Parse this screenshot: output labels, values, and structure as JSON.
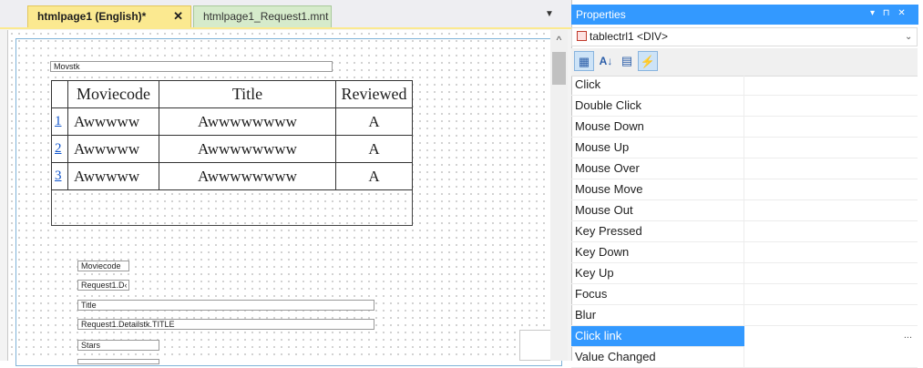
{
  "tabs": {
    "active": "htmlpage1 (English)*",
    "close": "✕",
    "inactive": "htmlpage1_Request1.mnt",
    "dropdown": "▼"
  },
  "designer": {
    "scroll_up": "^",
    "movstk_label": "Movstk",
    "table": {
      "headers": [
        "",
        "Moviecode",
        "Title",
        "Reviewed"
      ],
      "rows": [
        {
          "num": "1",
          "code": "Awwwww",
          "title": "Awwwwwwww",
          "reviewed": "A"
        },
        {
          "num": "2",
          "code": "Awwwww",
          "title": "Awwwwwwww",
          "reviewed": "A"
        },
        {
          "num": "3",
          "code": "Awwwww",
          "title": "Awwwwwwww",
          "reviewed": "A"
        }
      ]
    },
    "fields": {
      "moviecode": "Moviecode",
      "request1_d": "Request1.D‹",
      "title": "Title",
      "request1_title": "Request1.Detailstk.TITLE",
      "stars": "Stars"
    }
  },
  "properties": {
    "title": "Properties",
    "title_icons": "▾ ⊓ ✕",
    "object": "tablectrl1 <DIV>",
    "object_chevron": "⌄",
    "toolbar": {
      "categorized": "▦",
      "alphabetical": "A↓",
      "props": "▤",
      "events": "⚡"
    },
    "events": [
      "Click",
      "Double Click",
      "Mouse Down",
      "Mouse Up",
      "Mouse Over",
      "Mouse Move",
      "Mouse Out",
      "Key Pressed",
      "Key Down",
      "Key Up",
      "Focus",
      "Blur",
      "Click link",
      "Value Changed"
    ],
    "selected_event": "Click link",
    "ellipsis": "..."
  },
  "colors": {
    "accent": "#3399ff",
    "active_tab": "#fbe990",
    "inactive_tab": "#d6ebcb"
  }
}
